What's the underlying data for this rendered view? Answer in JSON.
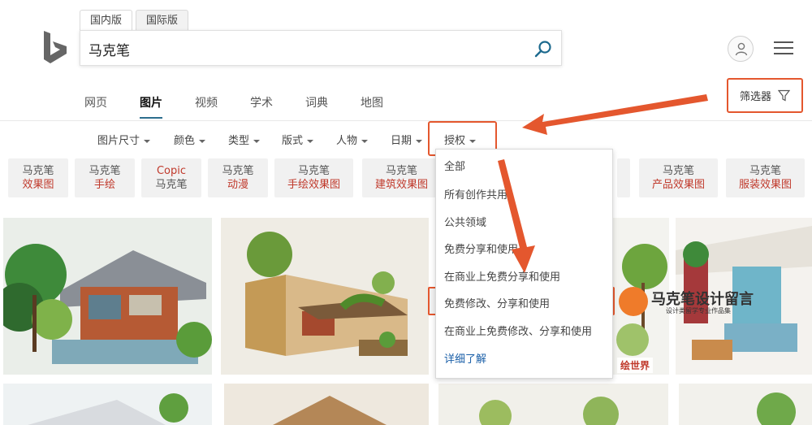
{
  "header": {
    "scope_tabs": [
      "国内版",
      "国际版"
    ],
    "search_value": "马克笔"
  },
  "nav": {
    "items": [
      "网页",
      "图片",
      "视频",
      "学术",
      "词典",
      "地图"
    ],
    "active": "图片"
  },
  "filter_button": {
    "label": "筛选器"
  },
  "filters": [
    "图片尺寸",
    "颜色",
    "类型",
    "版式",
    "人物",
    "日期",
    "授权"
  ],
  "related": [
    {
      "line1": "马克笔",
      "line2": "效果图"
    },
    {
      "line1": "马克笔",
      "line2": "手绘"
    },
    {
      "line1": "Copic",
      "line2": "马克笔"
    },
    {
      "line1": "马克笔",
      "line2": "动漫"
    },
    {
      "line1": "马克笔",
      "line2": "手绘效果图"
    },
    {
      "line1": "马克笔",
      "line2": "建筑效果图"
    },
    {
      "line1": "马克笔",
      "line2": "产品效果图"
    },
    {
      "line1": "马克笔",
      "line2": "服装效果图"
    }
  ],
  "license_menu": {
    "items": [
      "全部",
      "所有创作共用",
      "公共领域",
      "免费分享和使用",
      "在商业上免费分享和使用",
      "免费修改、分享和使用",
      "在商业上免费修改、分享和使用"
    ],
    "learn_more": "详细了解",
    "highlighted": "免费修改、分享和使用"
  },
  "watermark": {
    "title": "马克笔设计留言",
    "subtitle": "设计类留学专业作品集"
  },
  "badge": {
    "label": "绘世界"
  },
  "colors": {
    "annotation": "#e4572e",
    "accent": "#2d6e8e",
    "related_text": "#c0392b"
  }
}
